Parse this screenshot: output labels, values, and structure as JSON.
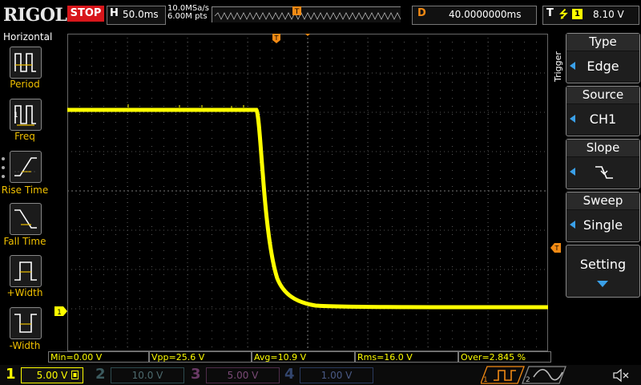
{
  "header": {
    "brand": "RIGOL",
    "run_state": "STOP",
    "timebase_letter": "H",
    "timebase_value": "50.0ms",
    "sample_rate": "10.0MSa/s",
    "memory_depth": "6.00M pts",
    "delay_letter": "D",
    "delay_value": "40.0000000ms",
    "trigger_letter": "T",
    "trigger_slope_symbol": "⭍",
    "trigger_channel": "1",
    "trigger_level": "8.10 V"
  },
  "left_menu": {
    "title": "Horizontal",
    "items": [
      {
        "label": "Period",
        "icon": "period-icon"
      },
      {
        "label": "Freq",
        "icon": "frequency-icon"
      },
      {
        "label": "Rise Time",
        "icon": "rise-time-icon"
      },
      {
        "label": "Fall Time",
        "icon": "fall-time-icon"
      },
      {
        "label": "+Width",
        "icon": "positive-width-icon"
      },
      {
        "label": "-Width",
        "icon": "negative-width-icon"
      }
    ]
  },
  "trigger_menu": {
    "side_label": "Trigger",
    "type": {
      "title": "Type",
      "value": "Edge"
    },
    "source": {
      "title": "Source",
      "value": "CH1"
    },
    "slope": {
      "title": "Slope",
      "value_icon": "falling-edge-icon"
    },
    "sweep": {
      "title": "Sweep",
      "value": "Single"
    },
    "setting": {
      "title": "Setting"
    }
  },
  "measurements": {
    "min": "Min=0.00 V",
    "vpp": "Vpp=25.6 V",
    "avg": "Avg=10.9 V",
    "rms": "Rms=16.0 V",
    "over": "Over=2.845 %"
  },
  "channels": [
    {
      "num": "1",
      "scale": "5.00 V",
      "color": "#ffff00",
      "active": true
    },
    {
      "num": "2",
      "scale": "10.0 V",
      "color": "#00c8d8",
      "active": false
    },
    {
      "num": "3",
      "scale": "5.00 V",
      "color": "#d040c8",
      "active": false
    },
    {
      "num": "4",
      "scale": "1.00 V",
      "color": "#3070e0",
      "active": false
    }
  ],
  "math_labels": [
    "1",
    "2"
  ],
  "markers": {
    "trigger_pos_label": "T",
    "ch1_ground_label": "1"
  },
  "colors": {
    "ch1": "#ffff00",
    "accent_orange": "#f28a14",
    "stop_red": "#d8161b",
    "menu_arrow": "#3aa0e8"
  }
}
